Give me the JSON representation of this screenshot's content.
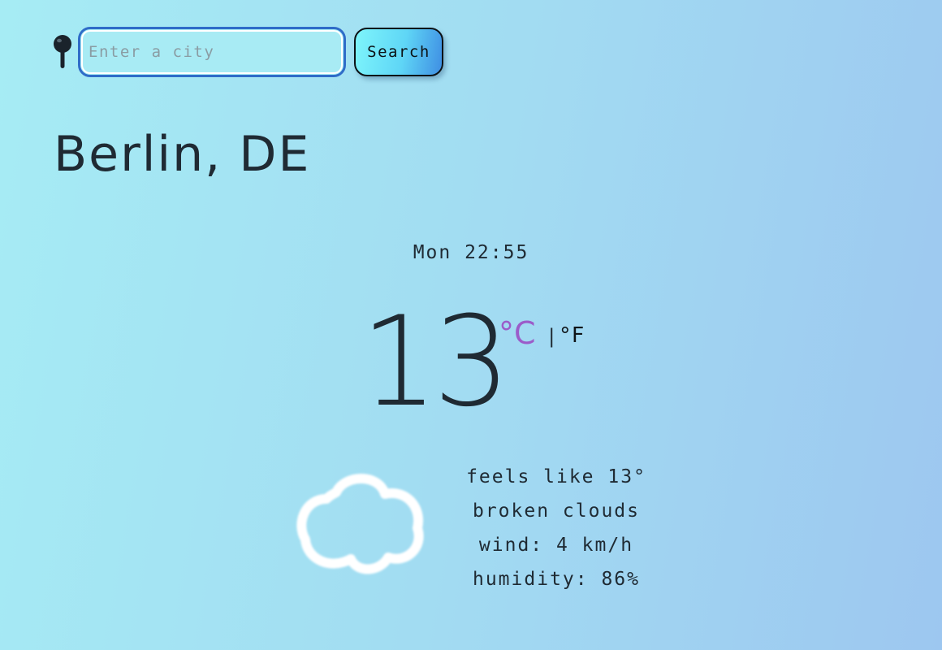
{
  "search": {
    "placeholder": "Enter a city",
    "value": "",
    "button_label": "Search"
  },
  "icons": {
    "location": "map-pin-icon",
    "weather": "cloud-icon"
  },
  "city": "Berlin, DE",
  "datetime": "Mon 22:55",
  "temperature": {
    "value": "13",
    "unit_celsius": "°C",
    "separator": "|",
    "unit_fahrenheit": "°F",
    "active_unit": "celsius"
  },
  "details": {
    "feels_like": "feels like 13°",
    "description": "broken clouds",
    "wind": "wind: 4 km/h",
    "humidity": "humidity: 86%"
  },
  "colors": {
    "active_unit": "#9b5cc9",
    "input_border": "#2f6cc8",
    "text": "#1f2a33"
  }
}
